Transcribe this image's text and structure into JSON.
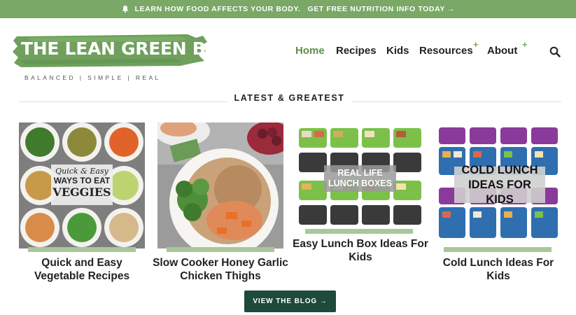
{
  "banner": {
    "text": "LEARN HOW FOOD AFFECTS YOUR BODY.",
    "link": "GET FREE NUTRITION INFO TODAY →"
  },
  "logo": {
    "title": "THE LEAN GREEN BEAN",
    "tagline": "BALANCED | SIMPLE | REAL"
  },
  "nav": {
    "items": [
      {
        "label": "Home",
        "active": true
      },
      {
        "label": "Recipes"
      },
      {
        "label": "Kids"
      },
      {
        "label": "Resources",
        "plus": "+"
      },
      {
        "label": "About",
        "plus": "+"
      }
    ]
  },
  "section": {
    "title": "LATEST & GREATEST"
  },
  "cards": [
    {
      "title": "Quick and Easy Vegetable Recipes",
      "overlay_line1": "Quick & Easy",
      "overlay_line2": "WAYS TO EAT",
      "overlay_line3": "VEGGIES"
    },
    {
      "title": "Slow Cooker Honey Garlic Chicken Thighs"
    },
    {
      "title": "Easy Lunch Box Ideas For Kids",
      "overlay": "REAL LIFE LUNCH BOXES"
    },
    {
      "title": "Cold Lunch Ideas For Kids",
      "overlay": "COLD LUNCH IDEAS FOR KIDS"
    }
  ],
  "cta": {
    "label": "VIEW THE BLOG →"
  },
  "colors": {
    "accent": "#7aa866",
    "button": "#1e4a3a",
    "bar": "#a9c79a"
  }
}
